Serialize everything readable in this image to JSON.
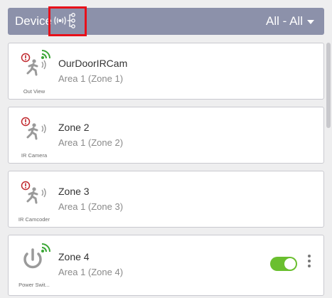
{
  "header": {
    "title": "Device",
    "filter": "All - All",
    "topology_icon": "device-topology-icon"
  },
  "devices": [
    {
      "name": "OurDoorIRCam",
      "location": "Area 1 (Zone 1)",
      "type_label": "Out View",
      "icon": "motion-sensor-icon",
      "alert": true,
      "signal": true
    },
    {
      "name": "Zone 2",
      "location": "Area 1 (Zone 2)",
      "type_label": "IR Camera",
      "icon": "motion-sensor-icon",
      "alert": true,
      "signal": false
    },
    {
      "name": "Zone 3",
      "location": "Area 1 (Zone 3)",
      "type_label": "IR Camcoder",
      "icon": "motion-sensor-icon",
      "alert": true,
      "signal": false
    },
    {
      "name": "Zone 4",
      "location": "Area 1 (Zone 4)",
      "type_label": "Power Swit...",
      "icon": "power-switch-icon",
      "alert": false,
      "signal": true,
      "switch_on": true
    }
  ],
  "colors": {
    "header_bg": "#8c91aa",
    "highlight": "#e8101a",
    "alert": "#c0282d",
    "signal": "#3aa635",
    "toggle_on": "#6abf2f"
  }
}
